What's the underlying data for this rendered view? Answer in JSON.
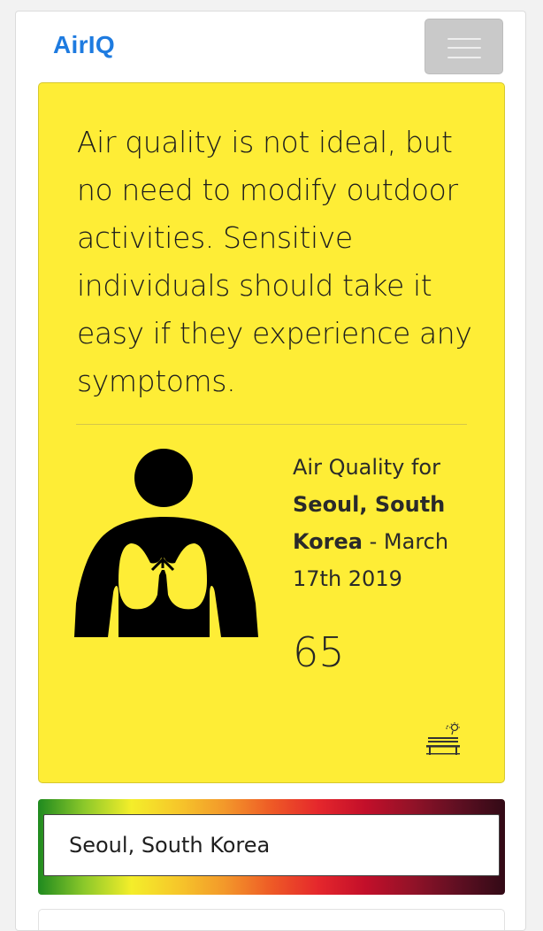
{
  "navbar": {
    "brand": "AirIQ",
    "toggler_icon": "hamburger-menu-icon"
  },
  "card": {
    "background_color": "#feed36",
    "advice_text": "Air quality is not ideal, but no need to modify outdoor activities. Sensitive individuals should take it easy if they experience any symptoms.",
    "icon": "lungs-person-icon",
    "aq_label": "Air Quality for",
    "location": "Seoul, South Korea",
    "separator": " - ",
    "date": "March 17th 2019",
    "aqi_value": "65",
    "bench_icon": "park-bench-sun-icon"
  },
  "search": {
    "value": "Seoul, South Korea",
    "gradient_colors": [
      "#1f8a1f",
      "#f4ee2a",
      "#f3982a",
      "#e5272c",
      "#931228",
      "#320a16"
    ]
  }
}
